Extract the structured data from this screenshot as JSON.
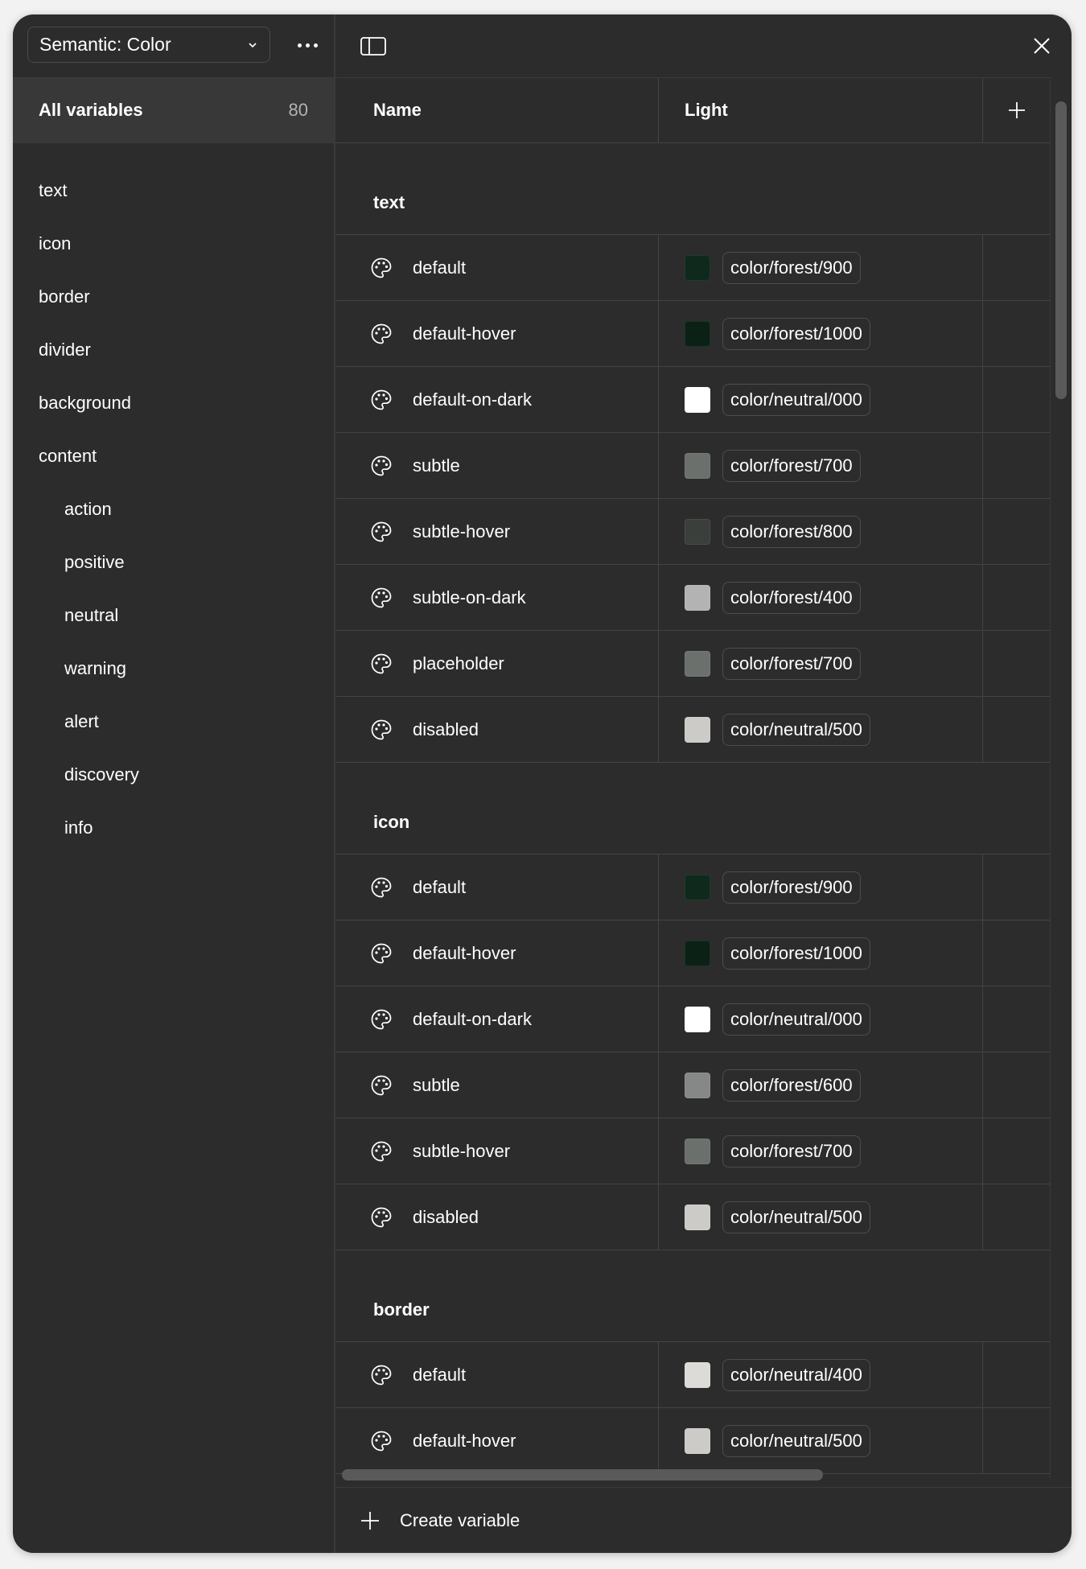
{
  "sidebar": {
    "collection_label": "Semantic: Color",
    "all_variables": {
      "label": "All variables",
      "count": "80"
    },
    "groups": [
      {
        "label": "text",
        "indent": false
      },
      {
        "label": "icon",
        "indent": false
      },
      {
        "label": "border",
        "indent": false
      },
      {
        "label": "divider",
        "indent": false
      },
      {
        "label": "background",
        "indent": false
      },
      {
        "label": "content",
        "indent": false
      },
      {
        "label": "action",
        "indent": true
      },
      {
        "label": "positive",
        "indent": true
      },
      {
        "label": "neutral",
        "indent": true
      },
      {
        "label": "warning",
        "indent": true
      },
      {
        "label": "alert",
        "indent": true
      },
      {
        "label": "discovery",
        "indent": true
      },
      {
        "label": "info",
        "indent": true
      }
    ]
  },
  "table": {
    "headers": {
      "name": "Name",
      "light": "Light"
    },
    "sections": [
      {
        "title": "text",
        "rows": [
          {
            "name": "default",
            "swatch": "#0f2a1d",
            "alias": "color/forest/900"
          },
          {
            "name": "default-hover",
            "swatch": "#0b2116",
            "alias": "color/forest/1000"
          },
          {
            "name": "default-on-dark",
            "swatch": "#ffffff",
            "alias": "color/neutral/000"
          },
          {
            "name": "subtle",
            "swatch": "#6b706d",
            "alias": "color/forest/700"
          },
          {
            "name": "subtle-hover",
            "swatch": "#3a3f3c",
            "alias": "color/forest/800"
          },
          {
            "name": "subtle-on-dark",
            "swatch": "#b3b3b3",
            "alias": "color/forest/400"
          },
          {
            "name": "placeholder",
            "swatch": "#6b706d",
            "alias": "color/forest/700"
          },
          {
            "name": "disabled",
            "swatch": "#cccbc8",
            "alias": "color/neutral/500"
          }
        ]
      },
      {
        "title": "icon",
        "rows": [
          {
            "name": "default",
            "swatch": "#0f2a1d",
            "alias": "color/forest/900"
          },
          {
            "name": "default-hover",
            "swatch": "#0b2116",
            "alias": "color/forest/1000"
          },
          {
            "name": "default-on-dark",
            "swatch": "#ffffff",
            "alias": "color/neutral/000"
          },
          {
            "name": "subtle",
            "swatch": "#858886",
            "alias": "color/forest/600"
          },
          {
            "name": "subtle-hover",
            "swatch": "#6b706d",
            "alias": "color/forest/700"
          },
          {
            "name": "disabled",
            "swatch": "#cccbc8",
            "alias": "color/neutral/500"
          }
        ]
      },
      {
        "title": "border",
        "rows": [
          {
            "name": "default",
            "swatch": "#dcdbd8",
            "alias": "color/neutral/400"
          },
          {
            "name": "default-hover",
            "swatch": "#cccbc8",
            "alias": "color/neutral/500"
          }
        ]
      }
    ]
  },
  "footer": {
    "create_label": "Create variable"
  },
  "icons": {
    "chevron": "chevron-down-icon",
    "more": "more-horizontal-icon",
    "panel": "sidebar-toggle-icon",
    "close": "close-icon",
    "add": "plus-icon",
    "variable": "palette-icon"
  }
}
